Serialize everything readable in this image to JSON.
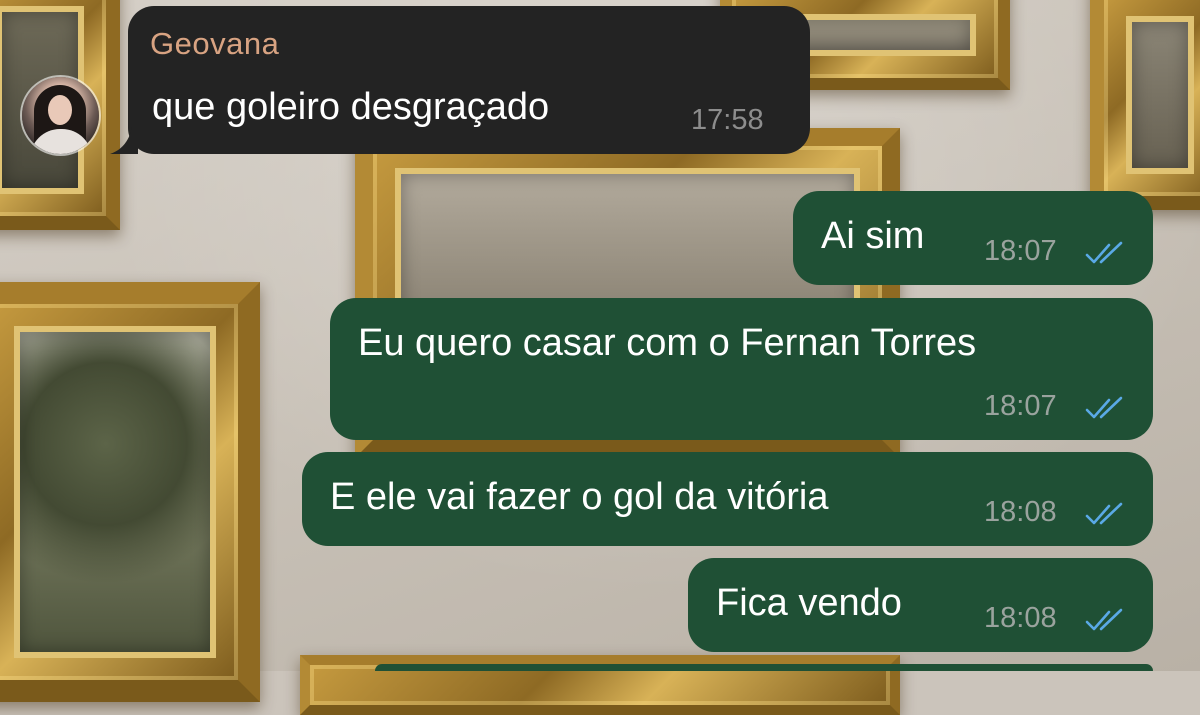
{
  "chat": {
    "messages": [
      {
        "direction": "incoming",
        "sender": "Geovana",
        "text": "que goleiro desgraçado",
        "time": "17:58"
      },
      {
        "direction": "outgoing",
        "text": "Ai sim",
        "time": "18:07",
        "status": "read"
      },
      {
        "direction": "outgoing",
        "text": "Eu quero casar com o Fernan Torres",
        "time": "18:07",
        "status": "read"
      },
      {
        "direction": "outgoing",
        "text": "E ele vai fazer o gol da vitória",
        "time": "18:08",
        "status": "read"
      },
      {
        "direction": "outgoing",
        "text": "Fica vendo",
        "time": "18:08",
        "status": "read"
      }
    ]
  },
  "colors": {
    "incoming_bubble": "#232323",
    "outgoing_bubble": "#1f5035",
    "sender_name": "#d8a382",
    "read_ticks": "#5aa9e6",
    "timestamp": "#9aa39e"
  },
  "icons": {
    "avatar": "contact-avatar",
    "read_status": "double-check-icon"
  }
}
